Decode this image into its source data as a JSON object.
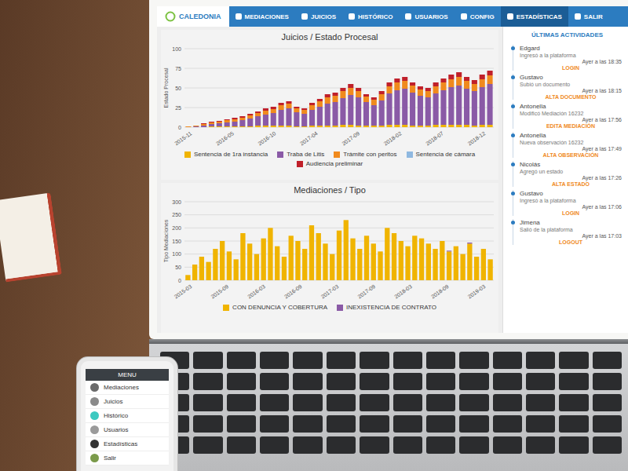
{
  "app": {
    "logo": "CALEDONIA",
    "nav": [
      {
        "label": "MEDIACIONES",
        "selected": false
      },
      {
        "label": "JUICIOS",
        "selected": false
      },
      {
        "label": "HISTÓRICO",
        "selected": false
      },
      {
        "label": "USUARIOS",
        "selected": false
      },
      {
        "label": "CONFIG",
        "selected": false
      },
      {
        "label": "ESTADÍSTICAS",
        "selected": true
      },
      {
        "label": "SALIR",
        "selected": false
      }
    ]
  },
  "charts": [
    {
      "title": "Juicios / Estado Procesal",
      "axis_label": "Estado Procesal",
      "y_ticks": [
        "100",
        "75",
        "50",
        "25",
        "0"
      ],
      "x_ticks": [
        "2015-11",
        "2016-05",
        "2016-10",
        "2017-04",
        "2017-09",
        "2018-02",
        "2018-07",
        "2018-12"
      ],
      "series": [
        {
          "name": "Sentencia de 1ra instancia",
          "color": "#f0b400",
          "values": [
            0,
            0,
            0,
            1,
            1,
            1,
            1,
            1,
            1,
            2,
            2,
            2,
            2,
            2,
            1,
            1,
            2,
            2,
            2,
            2,
            3,
            3,
            2,
            2,
            2,
            2,
            3,
            3,
            3,
            2,
            2,
            2,
            3,
            3,
            3,
            3,
            3,
            2,
            3,
            3
          ]
        },
        {
          "name": "Traba de Litis",
          "color": "#8a5aa6",
          "values": [
            0,
            1,
            2,
            3,
            4,
            5,
            6,
            8,
            10,
            12,
            14,
            16,
            20,
            22,
            18,
            16,
            20,
            24,
            28,
            30,
            34,
            38,
            36,
            30,
            26,
            32,
            40,
            44,
            46,
            42,
            38,
            36,
            40,
            44,
            48,
            50,
            46,
            44,
            48,
            52
          ]
        },
        {
          "name": "Trámite con peritos",
          "color": "#f08a1e",
          "values": [
            1,
            1,
            2,
            2,
            2,
            3,
            3,
            3,
            4,
            4,
            5,
            5,
            6,
            6,
            5,
            5,
            6,
            7,
            8,
            8,
            9,
            9,
            8,
            7,
            7,
            8,
            9,
            10,
            10,
            9,
            8,
            8,
            9,
            10,
            10,
            11,
            10,
            9,
            10,
            11
          ]
        },
        {
          "name": "Sentencia de cámara",
          "color": "#8fb8e0",
          "values": []
        },
        {
          "name": "Audiencia preliminar",
          "color": "#c0202a",
          "values": [
            0,
            0,
            1,
            1,
            1,
            1,
            2,
            2,
            2,
            2,
            3,
            3,
            3,
            3,
            2,
            2,
            3,
            3,
            4,
            4,
            4,
            5,
            4,
            3,
            3,
            4,
            5,
            5,
            5,
            4,
            4,
            4,
            5,
            5,
            6,
            6,
            5,
            5,
            6,
            6
          ]
        }
      ]
    },
    {
      "title": "Mediaciones / Tipo",
      "axis_label": "Tipo Mediaciones",
      "y_ticks": [
        "300",
        "250",
        "200",
        "150",
        "100",
        "50",
        "0"
      ],
      "x_ticks": [
        "2015-03",
        "2015-09",
        "2016-03",
        "2016-09",
        "2017-03",
        "2017-09",
        "2018-03",
        "2018-09",
        "2019-03"
      ],
      "series": [
        {
          "name": "CON DENUNCIA Y COBERTURA",
          "color": "#f0b400",
          "values": [
            20,
            60,
            90,
            70,
            120,
            150,
            110,
            80,
            180,
            140,
            100,
            160,
            200,
            130,
            90,
            170,
            150,
            120,
            210,
            180,
            140,
            100,
            190,
            230,
            160,
            120,
            170,
            140,
            110,
            200,
            180,
            150,
            130,
            170,
            160,
            140,
            120,
            150,
            110,
            130,
            100,
            140,
            90,
            120,
            80
          ]
        },
        {
          "name": "INEXISTENCIA DE CONTRATO",
          "color": "#8a5aa6",
          "values": [
            0,
            0,
            0,
            0,
            0,
            0,
            0,
            0,
            0,
            0,
            0,
            0,
            0,
            0,
            0,
            0,
            0,
            0,
            0,
            0,
            0,
            0,
            0,
            0,
            0,
            0,
            0,
            0,
            0,
            0,
            0,
            0,
            0,
            0,
            0,
            0,
            0,
            0,
            3,
            0,
            0,
            4,
            0,
            0,
            0
          ]
        }
      ]
    }
  ],
  "activity": {
    "title": "ÚLTIMAS ACTIVIDADES",
    "items": [
      {
        "name": "Edgard",
        "text": "Ingresó a la plataforma",
        "time": "Ayer a las 18:35",
        "badge": "LOGIN"
      },
      {
        "name": "Gustavo",
        "text": "Subió un documento",
        "time": "Ayer a las 18:15",
        "badge": "ALTA DOCUMENTO"
      },
      {
        "name": "Antonella",
        "text": "Modificó Mediación 16232",
        "time": "Ayer a las 17:56",
        "badge": "EDITA MEDIACIÓN"
      },
      {
        "name": "Antonella",
        "text": "Nueva observación 16232",
        "time": "Ayer a las 17:49",
        "badge": "ALTA OBSERVACIÓN"
      },
      {
        "name": "Nicolás",
        "text": "Agregó un estado",
        "time": "Ayer a las 17:26",
        "badge": "ALTA ESTADO"
      },
      {
        "name": "Gustavo",
        "text": "Ingresó a la plataforma",
        "time": "Ayer a las 17:06",
        "badge": "LOGIN"
      },
      {
        "name": "Jimena",
        "text": "Salió de la plataforma",
        "time": "Ayer a las 17:03",
        "badge": "LOGOUT"
      }
    ]
  },
  "phone": {
    "header": "MENU",
    "items": [
      {
        "label": "Mediaciones",
        "color": "#6b6b6b"
      },
      {
        "label": "Juicios",
        "color": "#8a8a8a"
      },
      {
        "label": "Histórico",
        "color": "#3cc9c0"
      },
      {
        "label": "Usuarios",
        "color": "#9a9a9a"
      },
      {
        "label": "Estadísticas",
        "color": "#333333"
      },
      {
        "label": "Salir",
        "color": "#7a9a4a"
      }
    ]
  }
}
